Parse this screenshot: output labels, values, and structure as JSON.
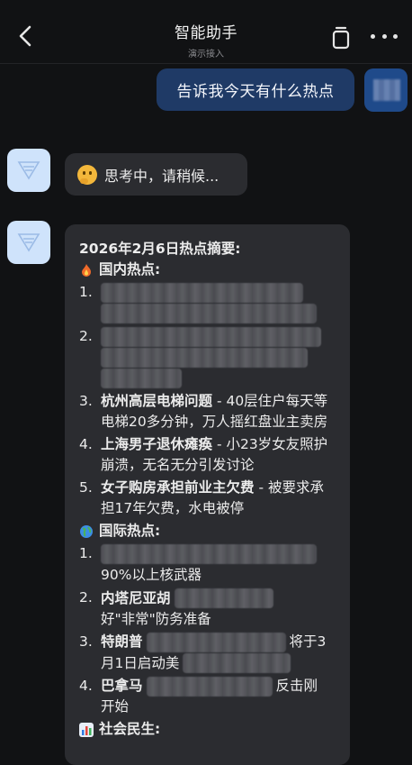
{
  "header": {
    "title": "智能助手",
    "subtitle": "演示接入",
    "back_icon": "chevron-left-icon",
    "copy_icon": "copy-icon",
    "more_icon": "more-dots-icon"
  },
  "messages": {
    "user_prompt": "告诉我今天有什么热点",
    "thinking": "思考中，请稍候..."
  },
  "answer": {
    "title": "2026年2月6日热点摘要:",
    "domestic_header": "国内热点:",
    "domestic": [
      {
        "num": "1.",
        "title": "",
        "desc": ""
      },
      {
        "num": "2.",
        "title": "",
        "desc": ""
      },
      {
        "num": "3.",
        "title": "杭州高层电梯问题",
        "desc": " - 40层住户每天等电梯20多分钟，万人摇红盘业主卖房"
      },
      {
        "num": "4.",
        "title": "上海男子退休瘫痪",
        "desc": " - 小23岁女友照护崩溃，无名无分引发讨论"
      },
      {
        "num": "5.",
        "title": "女子购房承担前业主欠费",
        "desc": " - 被要求承担17年欠费，水电被停"
      }
    ],
    "intl_header": "国际热点:",
    "intl": [
      {
        "num": "1.",
        "visible_line2": "90%以上核武器"
      },
      {
        "num": "2.",
        "visible_line1_start": "内塔尼亚胡",
        "visible_line2": "好\"非常\"防务准备"
      },
      {
        "num": "3.",
        "visible_line1_start": "特朗普",
        "visible_line1_end": "将于3",
        "visible_line2": "月1日启动美"
      },
      {
        "num": "4.",
        "visible_line1_start": "巴拿马",
        "visible_line1_end": "反击刚",
        "visible_line2": "开始"
      }
    ],
    "social_header": "社会民生:"
  },
  "colors": {
    "background": "#111214",
    "user_bubble": "#1f3a66",
    "bot_bubble": "#2b2c30",
    "bot_avatar": "#cfe3fb"
  }
}
